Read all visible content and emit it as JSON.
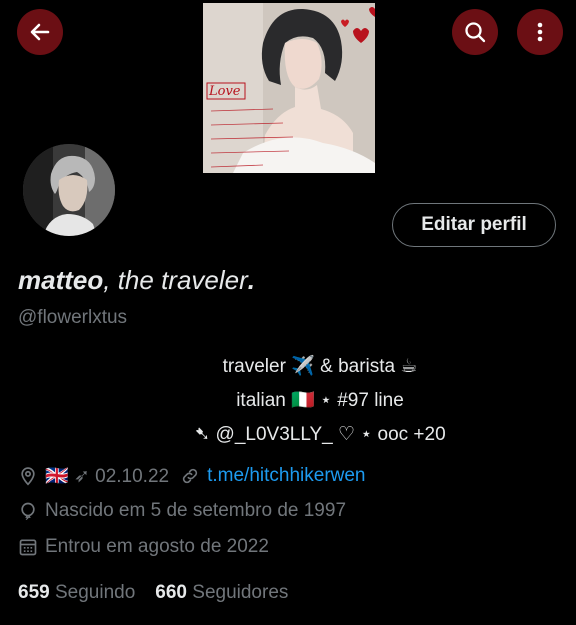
{
  "topbar": {
    "back_icon": "arrow-left-icon",
    "search_icon": "search-icon",
    "more_icon": "more-vertical-icon",
    "button_color": "#6b0f14"
  },
  "profile": {
    "name_bold": "matteo",
    "name_rest": ", the traveler",
    "name_end": ".",
    "handle": "@flowerlxtus",
    "edit_label": "Editar perfil"
  },
  "bio": {
    "line1": "traveler ✈️ & barista ☕",
    "line2": "italian 🇮🇹 ⋆ #97 line",
    "line3": "➷ @_L0V3LLY_ ♡ ⋆ ooc +20"
  },
  "meta": {
    "location": "🇬🇧 ➶ 02.10.22",
    "link": "t.me/hitchhikerwen",
    "birthday": "Nascido em 5 de setembro de 1997",
    "joined": "Entrou em agosto de 2022"
  },
  "stats": {
    "following_count": "659",
    "following_label": "Seguindo",
    "followers_count": "660",
    "followers_label": "Seguidores"
  },
  "banner": {
    "text_love": "Love",
    "text_side": "I Know you know I Love you"
  },
  "colors": {
    "background": "#000000",
    "text": "#e7e9ea",
    "muted": "#71767b",
    "link": "#1d9bf0"
  }
}
